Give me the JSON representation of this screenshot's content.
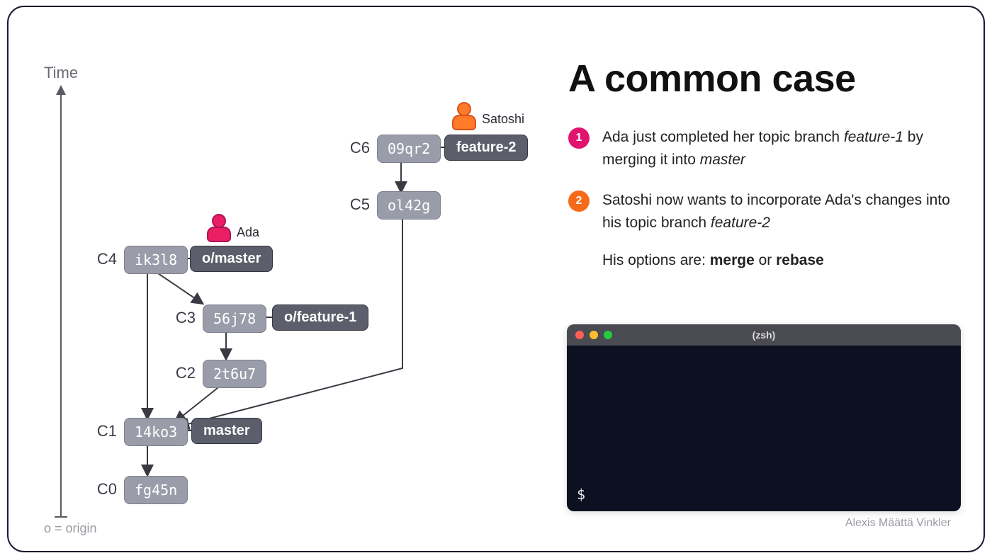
{
  "title": "A common case",
  "time_label": "Time",
  "legend": "o = origin",
  "avatars": {
    "ada": "Ada",
    "satoshi": "Satoshi"
  },
  "commits": {
    "c6": {
      "label": "C6",
      "hash": "09qr2"
    },
    "c5": {
      "label": "C5",
      "hash": "ol42g"
    },
    "c4": {
      "label": "C4",
      "hash": "ik3l8"
    },
    "c3": {
      "label": "C3",
      "hash": "56j78"
    },
    "c2": {
      "label": "C2",
      "hash": "2t6u7"
    },
    "c1": {
      "label": "C1",
      "hash": "14ko3"
    },
    "c0": {
      "label": "C0",
      "hash": "fg45n"
    }
  },
  "branches": {
    "feature2": "feature-2",
    "omaster": "o/master",
    "ofeature1": "o/feature-1",
    "master": "master"
  },
  "steps": {
    "s1": {
      "num": "1",
      "html": "Ada just completed her topic branch <em>feature-1</em> by merging it into <em>master</em>"
    },
    "s2": {
      "num": "2",
      "html": "Satoshi now wants to incorporate Ada's changes into his topic branch <em>feature-2</em>"
    }
  },
  "options_line": "His options are: <strong>merge</strong> or <strong>rebase</strong>",
  "terminal": {
    "title": "(zsh)",
    "prompt": "$"
  },
  "credit": "Alexis Määttä Vinkler"
}
